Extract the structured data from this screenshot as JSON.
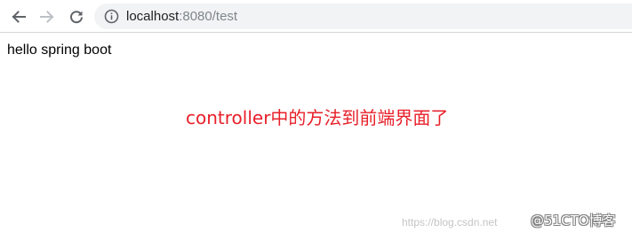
{
  "browser": {
    "back_icon": "arrow-left-icon",
    "forward_icon": "arrow-right-icon",
    "reload_icon": "reload-icon",
    "site_info_icon": "info-circle-icon",
    "url_host": "localhost",
    "url_rest": ":8080/test",
    "colors": {
      "icon_active": "#5f6368",
      "icon_disabled": "#bdc1c6",
      "omnibox_bg": "#f1f3f4",
      "url_host": "#202124",
      "url_rest": "#80868b"
    }
  },
  "page": {
    "body_text": "hello spring boot"
  },
  "annotation": {
    "text": "controller中的方法到前端界面了",
    "color": "#e8202a"
  },
  "watermark": {
    "url_text": "https://blog.csdn.net",
    "badge_text": "@51CTO博客"
  }
}
